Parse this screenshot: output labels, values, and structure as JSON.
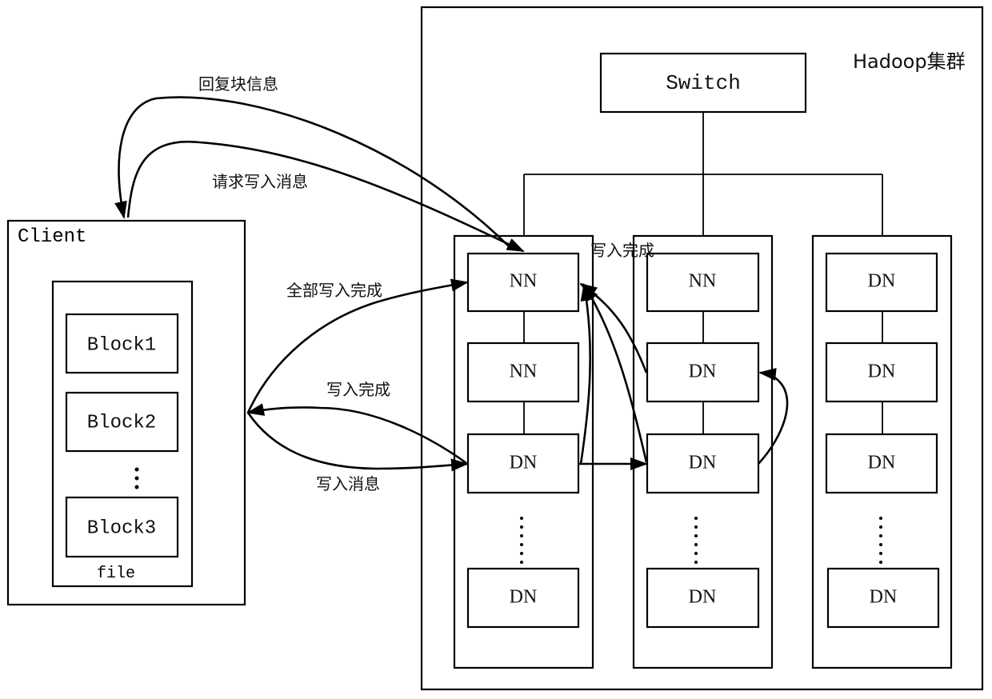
{
  "diagram": {
    "cluster": {
      "label": "Hadoop集群"
    },
    "switch": {
      "label": "Switch"
    },
    "client": {
      "label": "Client",
      "file": {
        "label": "file",
        "blocks": [
          "Block1",
          "Block2",
          "Block3"
        ]
      }
    },
    "racks": [
      {
        "nodes": [
          "NN",
          "NN",
          "DN",
          "DN"
        ]
      },
      {
        "nodes": [
          "NN",
          "DN",
          "DN",
          "DN"
        ]
      },
      {
        "nodes": [
          "DN",
          "DN",
          "DN",
          "DN"
        ]
      }
    ],
    "edges": [
      {
        "from": "rack1.NN1",
        "to": "client",
        "label": "回复块信息"
      },
      {
        "from": "client",
        "to": "rack1.NN1",
        "label": "请求写入消息"
      },
      {
        "from": "client",
        "to": "rack1.NN1",
        "label": "全部写入完成"
      },
      {
        "from": "rack1.DN3",
        "to": "client",
        "label": "写入完成"
      },
      {
        "from": "client",
        "to": "rack1.DN3",
        "label": "写入消息"
      },
      {
        "from": "rack1.DN3",
        "to": "rack2.DN3",
        "label": ""
      },
      {
        "from": "rack2.DN3",
        "to": "rack2.DN2",
        "label": ""
      },
      {
        "from": "rack2.DN2",
        "to": "rack1.NN1",
        "label": "写入完成"
      },
      {
        "from": "rack2.DN3",
        "to": "rack1.NN1",
        "label": ""
      },
      {
        "from": "rack1.DN3",
        "to": "rack1.NN1",
        "label": ""
      }
    ],
    "labels": {
      "reply_block_info": "回复块信息",
      "request_write": "请求写入消息",
      "all_write_done": "全部写入完成",
      "write_done_client": "写入完成",
      "write_message": "写入消息",
      "write_done_top": "写入完成",
      "ellipsis": "⋮"
    }
  }
}
